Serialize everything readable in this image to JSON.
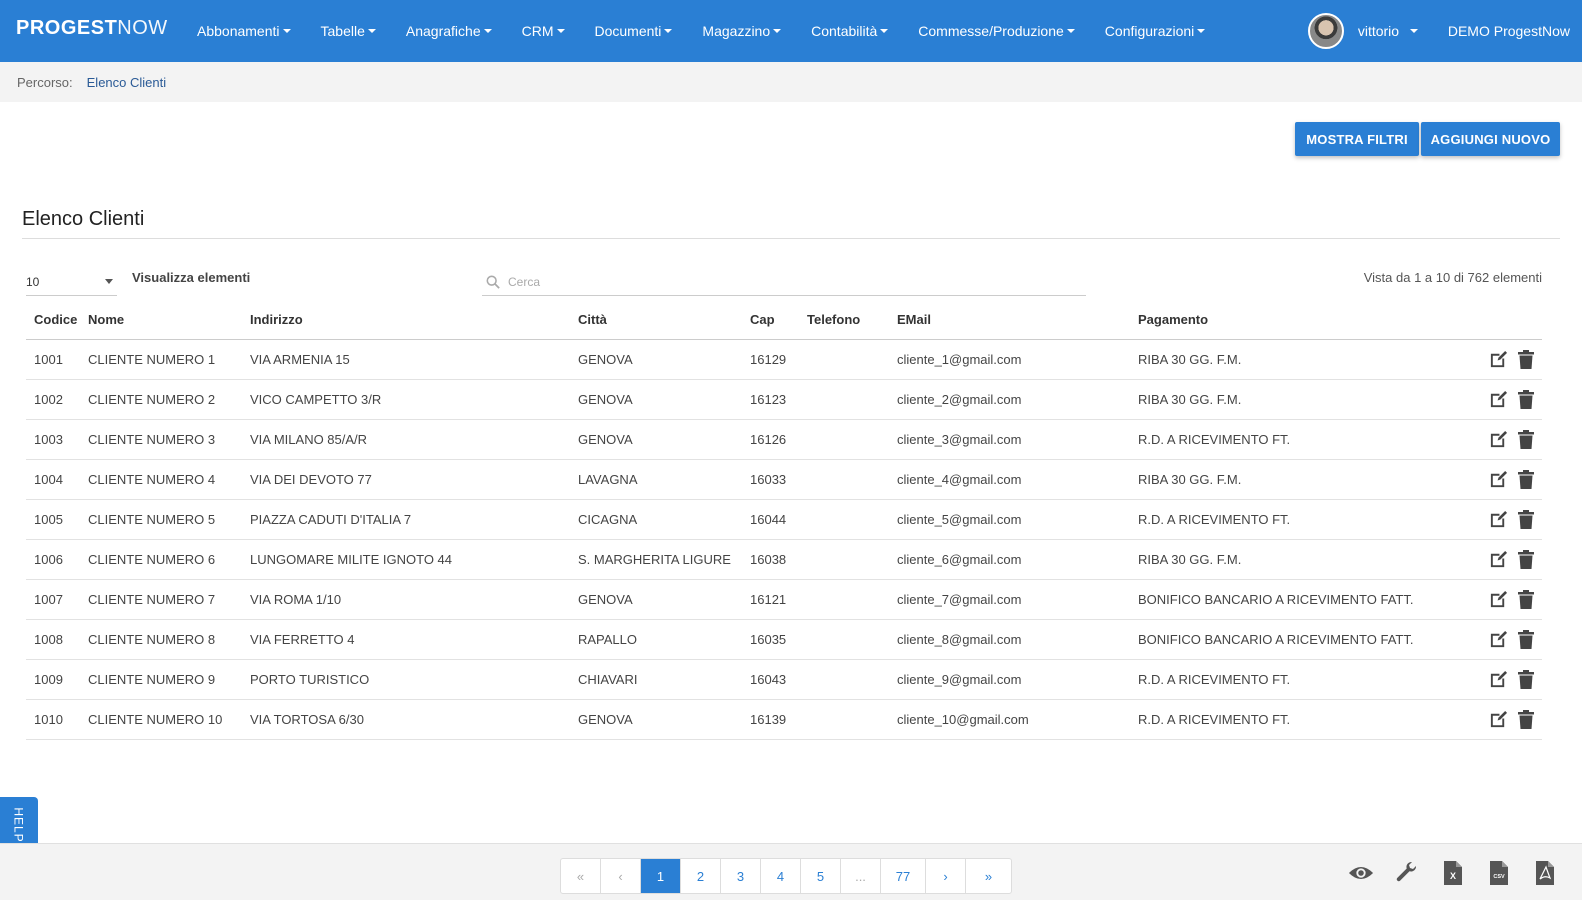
{
  "app": {
    "brand_bold": "PROGEST",
    "brand_thin": "NOW"
  },
  "nav": {
    "items": [
      {
        "label": "Abbonamenti"
      },
      {
        "label": "Tabelle"
      },
      {
        "label": "Anagrafiche"
      },
      {
        "label": "CRM"
      },
      {
        "label": "Documenti"
      },
      {
        "label": "Magazzino"
      },
      {
        "label": "Contabilità"
      },
      {
        "label": "Commesse/Produzione"
      },
      {
        "label": "Configurazioni"
      }
    ],
    "user": "vittorio",
    "company": "DEMO ProgestNow"
  },
  "breadcrumb": {
    "label": "Percorso:",
    "current": "Elenco Clienti"
  },
  "actions": {
    "filters": "MOSTRA FILTRI",
    "add": "AGGIUNGI NUOVO"
  },
  "section": {
    "title": "Elenco Clienti"
  },
  "controls": {
    "page_size": "10",
    "view_label": "Visualizza elementi",
    "search_placeholder": "Cerca",
    "summary": "Vista da 1 a 10 di 762 elementi"
  },
  "table": {
    "headers": [
      "Codice",
      "Nome",
      "Indirizzo",
      "Città",
      "Cap",
      "Telefono",
      "EMail",
      "Pagamento"
    ],
    "rows": [
      {
        "codice": "1001",
        "nome": "CLIENTE NUMERO 1",
        "indirizzo": "VIA ARMENIA 15",
        "citta": "GENOVA",
        "cap": "16129",
        "telefono": "",
        "email": "cliente_1@gmail.com",
        "pagamento": "RIBA 30 GG. F.M."
      },
      {
        "codice": "1002",
        "nome": "CLIENTE NUMERO 2",
        "indirizzo": "VICO CAMPETTO 3/R",
        "citta": "GENOVA",
        "cap": "16123",
        "telefono": "",
        "email": "cliente_2@gmail.com",
        "pagamento": "RIBA 30 GG. F.M."
      },
      {
        "codice": "1003",
        "nome": "CLIENTE NUMERO 3",
        "indirizzo": "VIA MILANO 85/A/R",
        "citta": "GENOVA",
        "cap": "16126",
        "telefono": "",
        "email": "cliente_3@gmail.com",
        "pagamento": "R.D. A RICEVIMENTO FT."
      },
      {
        "codice": "1004",
        "nome": "CLIENTE NUMERO 4",
        "indirizzo": "VIA DEI DEVOTO 77",
        "citta": "LAVAGNA",
        "cap": "16033",
        "telefono": "",
        "email": "cliente_4@gmail.com",
        "pagamento": "RIBA 30 GG. F.M."
      },
      {
        "codice": "1005",
        "nome": "CLIENTE NUMERO 5",
        "indirizzo": "PIAZZA CADUTI D'ITALIA 7",
        "citta": "CICAGNA",
        "cap": "16044",
        "telefono": "",
        "email": "cliente_5@gmail.com",
        "pagamento": "R.D. A RICEVIMENTO FT."
      },
      {
        "codice": "1006",
        "nome": "CLIENTE NUMERO 6",
        "indirizzo": "LUNGOMARE MILITE IGNOTO 44",
        "citta": "S. MARGHERITA LIGURE",
        "cap": "16038",
        "telefono": "",
        "email": "cliente_6@gmail.com",
        "pagamento": "RIBA 30 GG. F.M."
      },
      {
        "codice": "1007",
        "nome": "CLIENTE NUMERO 7",
        "indirizzo": "VIA ROMA 1/10",
        "citta": "GENOVA",
        "cap": "16121",
        "telefono": "",
        "email": "cliente_7@gmail.com",
        "pagamento": "BONIFICO BANCARIO A RICEVIMENTO FATT."
      },
      {
        "codice": "1008",
        "nome": "CLIENTE NUMERO 8",
        "indirizzo": "VIA FERRETTO 4",
        "citta": "RAPALLO",
        "cap": "16035",
        "telefono": "",
        "email": "cliente_8@gmail.com",
        "pagamento": "BONIFICO BANCARIO A RICEVIMENTO FATT."
      },
      {
        "codice": "1009",
        "nome": "CLIENTE NUMERO 9",
        "indirizzo": "PORTO TURISTICO",
        "citta": "CHIAVARI",
        "cap": "16043",
        "telefono": "",
        "email": "cliente_9@gmail.com",
        "pagamento": "R.D. A RICEVIMENTO FT."
      },
      {
        "codice": "1010",
        "nome": "CLIENTE NUMERO 10",
        "indirizzo": "VIA TORTOSA 6/30",
        "citta": "GENOVA",
        "cap": "16139",
        "telefono": "",
        "email": "cliente_10@gmail.com",
        "pagamento": "R.D. A RICEVIMENTO FT."
      }
    ],
    "row_icons": [
      "edit-icon",
      "trash-icon"
    ]
  },
  "help": {
    "label": "HELP"
  },
  "pagination": {
    "first": "«",
    "prev": "‹",
    "pages": [
      "1",
      "2",
      "3",
      "4",
      "5",
      "...",
      "77"
    ],
    "active": "1",
    "next": "›",
    "last": "»"
  },
  "footer_tools": [
    "eye-icon",
    "wrench-icon",
    "excel-icon",
    "csv-icon",
    "pdf-icon"
  ],
  "colors": {
    "primary": "#2a7fd4",
    "breadcrumb_bg": "#f3f3f3"
  }
}
